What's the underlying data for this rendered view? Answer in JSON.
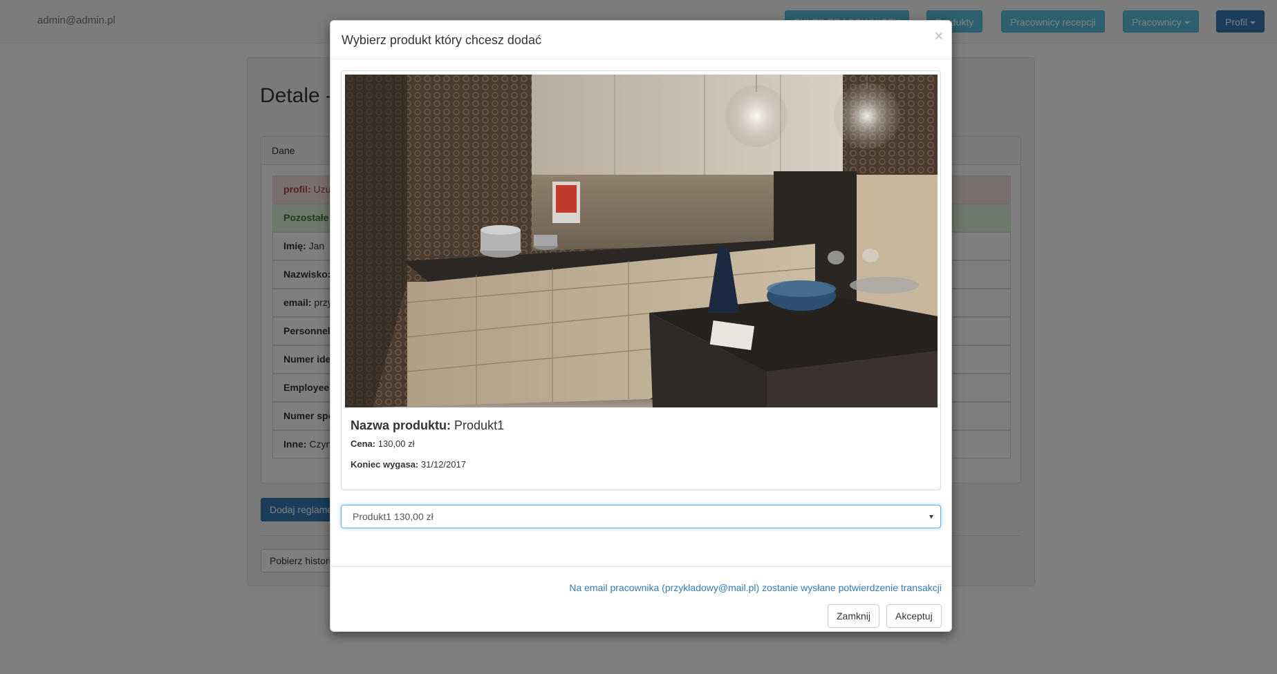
{
  "navbar": {
    "brand": "admin@admin.pl",
    "buttons": [
      {
        "label": "SKLEP PRACOWNICZY",
        "style": "info"
      },
      {
        "label": "Produkty",
        "style": "info"
      },
      {
        "label": "Pracownicy recepcji",
        "style": "info"
      },
      {
        "label": "Pracownicy",
        "style": "info",
        "dropdown": true
      },
      {
        "label": "Profil",
        "style": "primary",
        "dropdown": true
      }
    ]
  },
  "background_page": {
    "title": "Detale -",
    "panel_heading": "Dane",
    "rows": [
      {
        "label": "profil:",
        "value": "Uzu"
      },
      {
        "label": "Pozostałe",
        "value": ""
      },
      {
        "label": "Imię:",
        "value": "Jan"
      },
      {
        "label": "Nazwisko:",
        "value": ""
      },
      {
        "label": "email:",
        "value": "przy"
      },
      {
        "label": "Personnel",
        "value": ""
      },
      {
        "label": "Numer ide",
        "value": ""
      },
      {
        "label": "Employee",
        "value": ""
      },
      {
        "label": "Numer spo",
        "value": ""
      },
      {
        "label": "Inne:",
        "value": "Czyn"
      }
    ],
    "add_button": "Dodaj reglame",
    "history_button": "Pobierz histori"
  },
  "modal": {
    "title": "Wybierz produkt który chcesz dodać",
    "close_symbol": "×",
    "product": {
      "name_label": "Nazwa produktu:",
      "name_value": "Produkt1",
      "price_label": "Cena:",
      "price_value": "130,00 zł",
      "expiry_label": "Koniec wygasa:",
      "expiry_value": "31/12/2017"
    },
    "select": {
      "selected": "Produkt1 130,00 zł"
    },
    "footer_note": "Na email pracownika (przykladowy@mail.pl) zostanie wysłane potwierdzenie transakcji",
    "close_button": "Zamknij",
    "accept_button": "Akceptuj"
  },
  "colors": {
    "info": "#5bc0de",
    "primary": "#337ab7",
    "link": "#337ab7",
    "danger_bg": "#f2dede",
    "success_bg": "#dff0d8"
  },
  "icons": [
    "close-icon",
    "caret-down-icon",
    "select-arrow-icon"
  ]
}
